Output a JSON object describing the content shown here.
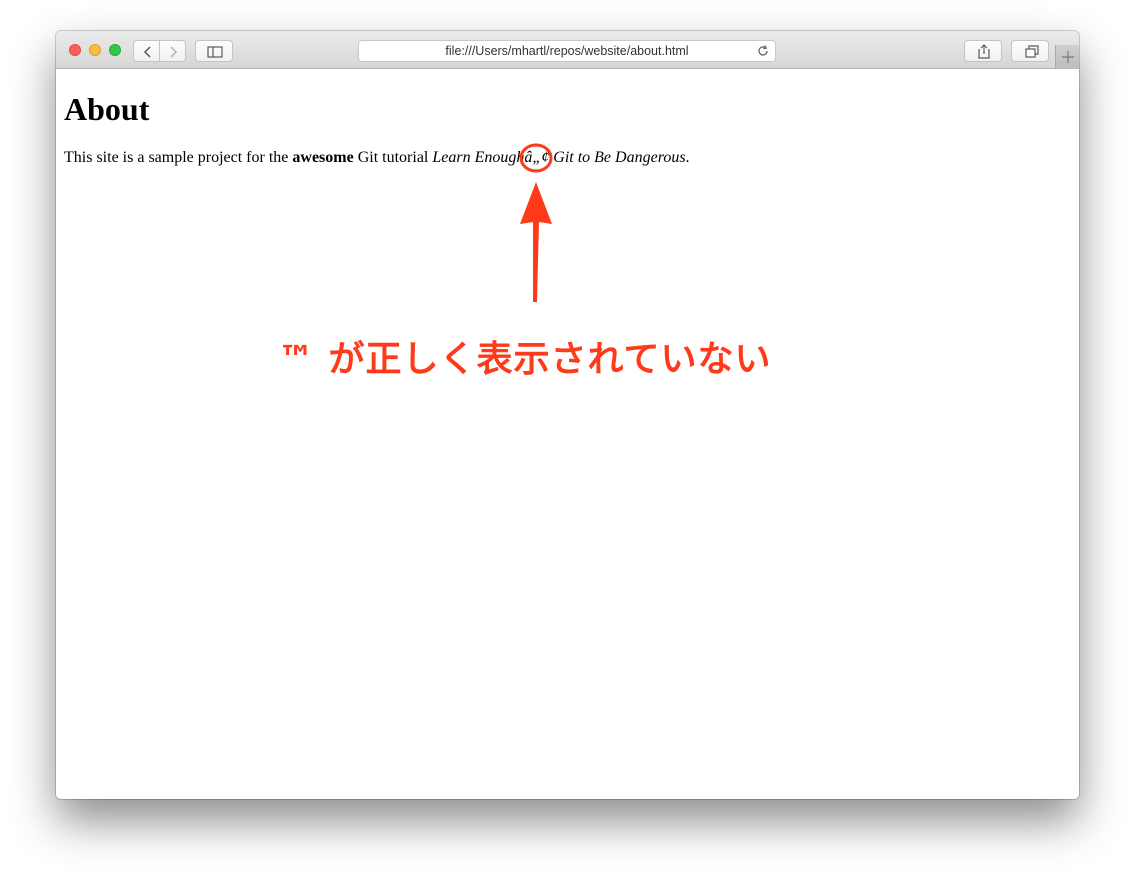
{
  "browser": {
    "url": "file:///Users/mhartl/repos/website/about.html"
  },
  "page": {
    "title": "About",
    "paragraph": {
      "before": "This site is a sample project for the ",
      "bold": "awesome",
      "middle": " Git tutorial ",
      "italic_start": "Learn Enough",
      "garbled": "â„¢",
      "italic_end": " Git to Be Dangerous",
      "after": "."
    }
  },
  "annotation": {
    "text": "™ が正しく表示されていない",
    "color": "#ff3a1a"
  }
}
